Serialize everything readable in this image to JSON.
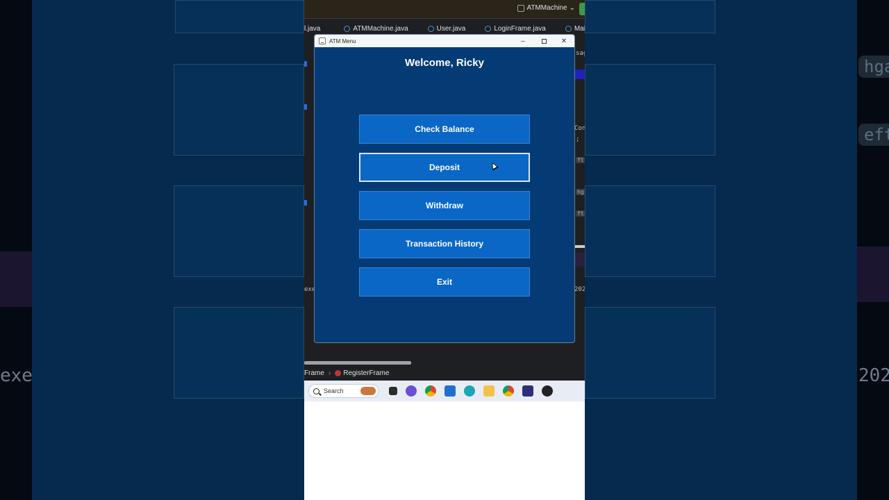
{
  "background": {
    "left_text": "exe",
    "right_text_1": "hga",
    "right_text_2": "eft:",
    "right_text_3": "202"
  },
  "ide": {
    "project_name": "ATMMachine",
    "tabs": [
      {
        "label": "l.java"
      },
      {
        "label": "ATMMachine.java"
      },
      {
        "label": "User.java"
      },
      {
        "label": "LoginFrame.java"
      },
      {
        "label": "MainMen"
      }
    ],
    "code_fragments": {
      "sag": "sag",
      "cons": "Cons",
      "semicolon": ";",
      "ft1": "ft:",
      "hg": "hg",
      "ft2": "ft:",
      "exe": "exe",
      "year": "202"
    },
    "breadcrumb": {
      "first": "Frame",
      "separator": "›",
      "second": "RegisterFrame"
    }
  },
  "atm_window": {
    "title": "ATM Menu",
    "controls": {
      "minimize": "–",
      "close": "✕"
    },
    "welcome": "Welcome, Ricky",
    "buttons": {
      "check_balance": "Check Balance",
      "deposit": "Deposit",
      "withdraw": "Withdraw",
      "transaction_history": "Transaction History",
      "exit": "Exit"
    }
  },
  "taskbar": {
    "search_placeholder": "Search",
    "icons": [
      "weather-icon",
      "task-view-icon",
      "chat-icon",
      "chrome-icon",
      "store-icon",
      "edge-icon",
      "file-explorer-icon",
      "chrome-profile-icon",
      "intellij-icon",
      "obs-icon"
    ]
  },
  "colors": {
    "atm_background": "#043b75",
    "atm_button": "#0a67c6"
  }
}
